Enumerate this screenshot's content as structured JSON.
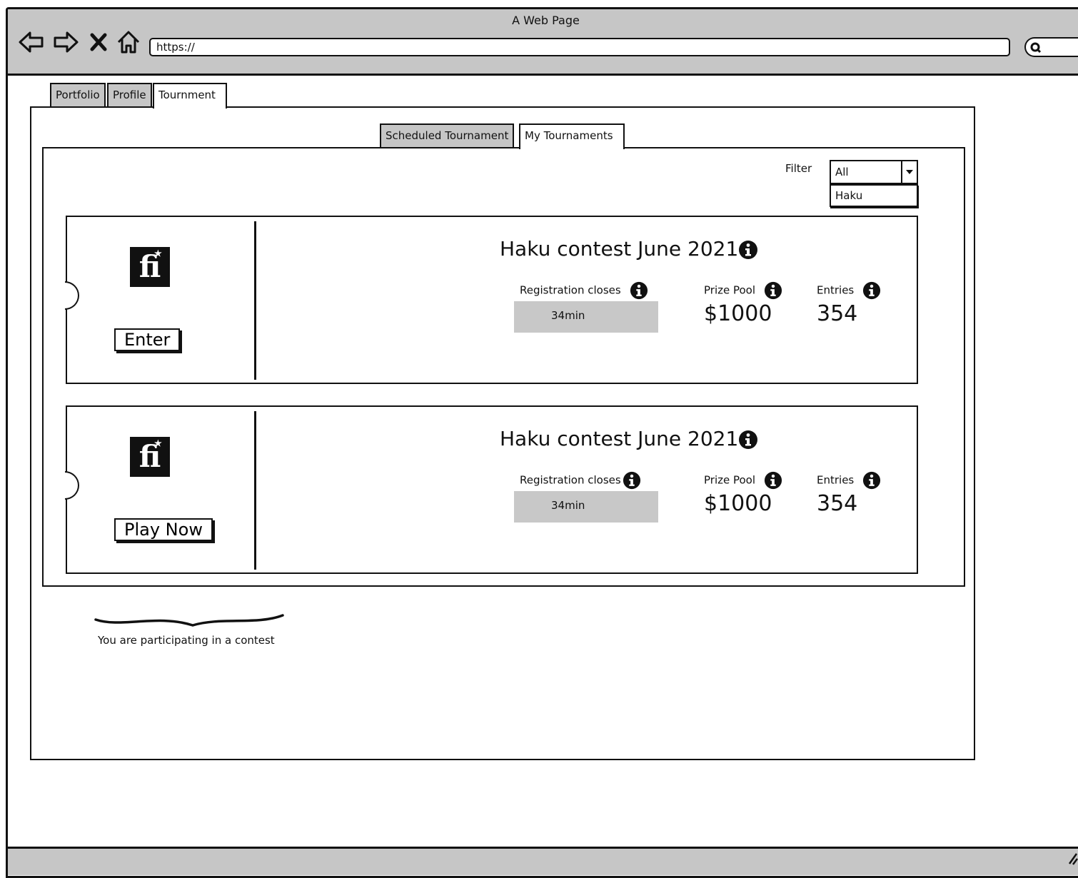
{
  "browser": {
    "window_title": "A Web Page",
    "url": "https://"
  },
  "main_tabs": [
    {
      "label": "Portfolio",
      "active": false
    },
    {
      "label": "Profile",
      "active": false
    },
    {
      "label": "Tournment",
      "active": true
    }
  ],
  "sub_tabs": [
    {
      "label": "Scheduled Tournament",
      "active": false
    },
    {
      "label": "My Tournaments",
      "active": true
    }
  ],
  "filter": {
    "label": "Filter",
    "selected": "All",
    "options": [
      "Haku"
    ]
  },
  "cards": [
    {
      "logo": "fi",
      "button_label": "Enter",
      "title": "Haku contest June 2021",
      "registration_label": "Registration closes",
      "registration_value": "34min",
      "prize_label": "Prize Pool",
      "prize_value": "$1000",
      "entries_label": "Entries",
      "entries_value": "354"
    },
    {
      "logo": "fi",
      "button_label": "Play Now",
      "title": "Haku contest June 2021",
      "registration_label": "Registration closes",
      "registration_value": "34min",
      "prize_label": "Prize Pool",
      "prize_value": "$1000",
      "entries_label": "Entries",
      "entries_value": "354"
    }
  ],
  "annotation": {
    "note": "You are participating in a contest"
  },
  "colors": {
    "chrome_gray": "#c6c6c6",
    "timer_gray": "#c8c8c8",
    "ink": "#111111"
  }
}
